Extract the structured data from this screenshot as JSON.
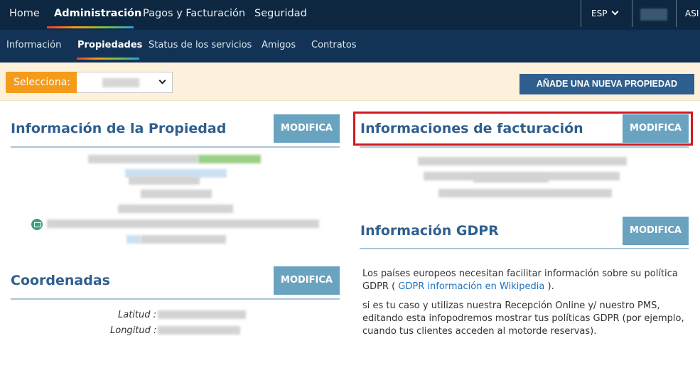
{
  "nav": {
    "items": [
      {
        "label": "Home"
      },
      {
        "label": "Administración"
      },
      {
        "label": "Pagos y Facturación"
      },
      {
        "label": "Seguridad"
      }
    ],
    "language": "ESP",
    "user_label": "ASI"
  },
  "subnav": {
    "items": [
      {
        "label": "Información"
      },
      {
        "label": "Propiedades"
      },
      {
        "label": "Status de los servicios"
      },
      {
        "label": "Amigos"
      },
      {
        "label": "Contratos"
      }
    ]
  },
  "selector": {
    "label": "Selecciona:",
    "add_button": "AÑADE UNA NUEVA PROPIEDAD"
  },
  "property_info": {
    "title": "Información de la Propiedad",
    "button": "MODIFICA"
  },
  "coordinates": {
    "title": "Coordenadas",
    "button": "MODIFICA",
    "latitude_label": "Latitud :",
    "longitude_label": "Longitud :"
  },
  "billing": {
    "title": "Informaciones de facturación",
    "button": "MODIFICA"
  },
  "gdpr": {
    "title": "Información GDPR",
    "button": "MODIFICA",
    "p1_before": "Los países europeos necesitan facilitar información sobre su política GDPR ( ",
    "p1_link": "GDPR información en Wikipedia",
    "p1_after": " ).",
    "p2": "si es tu caso y utilizas nuestra Recepción Online y/ nuestro PMS, editando esta infopodremos mostrar tus políticas GDPR (por ejemplo, cuando tus clientes acceden al motorde reservas)."
  },
  "colors": {
    "topbar": "#0d2740",
    "subbar": "#123355",
    "accent": "#2e5f8e",
    "button": "#6aa3c0",
    "highlight": "#d3171f",
    "selector_label": "#f59b1c"
  }
}
